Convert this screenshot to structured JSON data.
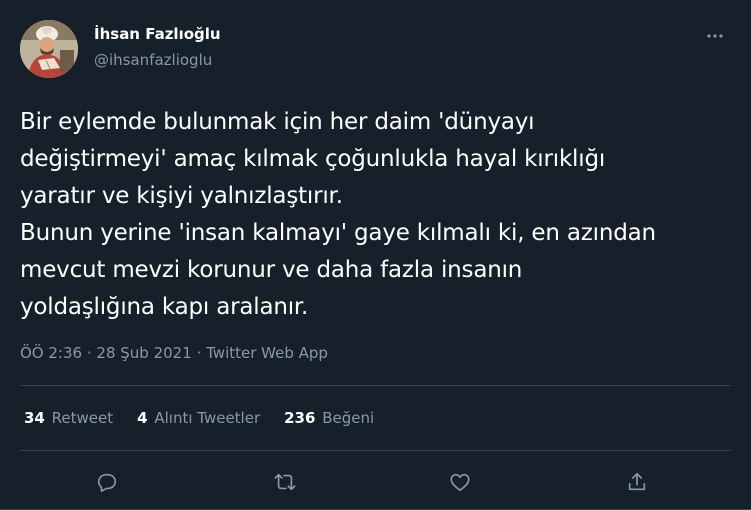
{
  "author": {
    "display_name": "İhsan Fazlıoğlu",
    "handle": "@ihsanfazlioglu",
    "avatar_icon": "portrait-avatar"
  },
  "tweet": {
    "lines": [
      "Bir eylemde bulunmak için her daim 'dünyayı",
      "değiştirmeyi' amaç kılmak çoğunlukla hayal kırıklığı",
      "yaratır ve kişiyi yalnızlaştırır.",
      "Bunun yerine 'insan kalmayı' gaye kılmalı ki, en azından",
      "mevcut mevzi korunur ve daha fazla insanın",
      "yoldaşlığına kapı aralanır."
    ]
  },
  "meta": {
    "time": "ÖÖ 2:36",
    "separator": "·",
    "date": "28 Şub 2021",
    "source": "Twitter Web App"
  },
  "stats": {
    "retweets": {
      "count": "34",
      "label": "Retweet"
    },
    "quotes": {
      "count": "4",
      "label": "Alıntı Tweetler"
    },
    "likes": {
      "count": "236",
      "label": "Beğeni"
    }
  },
  "actions": [
    "reply-icon",
    "retweet-icon",
    "like-icon",
    "share-icon"
  ],
  "colors": {
    "background": "#15202b",
    "text_primary": "#ffffff",
    "text_secondary": "#8899a6",
    "border": "#38444d"
  }
}
